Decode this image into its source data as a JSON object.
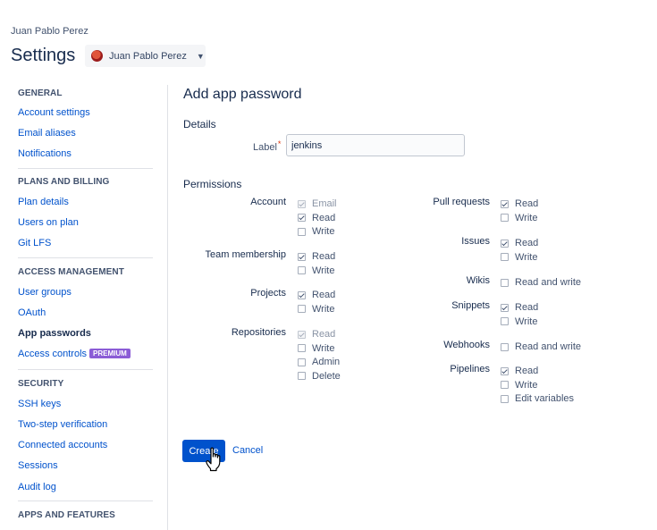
{
  "breadcrumb": "Juan Pablo Perez",
  "page_title": "Settings",
  "account_switcher": {
    "name": "Juan Pablo Perez",
    "icon": "chevron-down-icon"
  },
  "sidebar": {
    "general": {
      "heading": "GENERAL",
      "items": [
        "Account settings",
        "Email aliases",
        "Notifications"
      ]
    },
    "plans": {
      "heading": "PLANS AND BILLING",
      "items": [
        "Plan details",
        "Users on plan",
        "Git LFS"
      ]
    },
    "access": {
      "heading": "ACCESS MANAGEMENT",
      "items": [
        "User groups",
        "OAuth",
        "App passwords",
        "Access controls"
      ],
      "active_item": "App passwords",
      "premium_badge": "PREMIUM"
    },
    "security": {
      "heading": "SECURITY",
      "items": [
        "SSH keys",
        "Two-step verification",
        "Connected accounts",
        "Sessions",
        "Audit log"
      ]
    },
    "apps": {
      "heading": "APPS AND FEATURES"
    }
  },
  "form": {
    "title": "Add app password",
    "details_heading": "Details",
    "label_field": {
      "label": "Label",
      "required_marker": "*",
      "value": "jenkins"
    },
    "permissions_heading": "Permissions",
    "left_groups": [
      {
        "name": "Account",
        "options": [
          {
            "label": "Email",
            "checked": true,
            "disabled": true
          },
          {
            "label": "Read",
            "checked": true,
            "disabled": false
          },
          {
            "label": "Write",
            "checked": false,
            "disabled": false
          }
        ]
      },
      {
        "name": "Team membership",
        "options": [
          {
            "label": "Read",
            "checked": true,
            "disabled": false
          },
          {
            "label": "Write",
            "checked": false,
            "disabled": false
          }
        ]
      },
      {
        "name": "Projects",
        "options": [
          {
            "label": "Read",
            "checked": true,
            "disabled": false
          },
          {
            "label": "Write",
            "checked": false,
            "disabled": false
          }
        ]
      },
      {
        "name": "Repositories",
        "options": [
          {
            "label": "Read",
            "checked": true,
            "disabled": true
          },
          {
            "label": "Write",
            "checked": false,
            "disabled": false
          },
          {
            "label": "Admin",
            "checked": false,
            "disabled": false
          },
          {
            "label": "Delete",
            "checked": false,
            "disabled": false
          }
        ]
      }
    ],
    "right_groups": [
      {
        "name": "Pull requests",
        "options": [
          {
            "label": "Read",
            "checked": true,
            "disabled": false
          },
          {
            "label": "Write",
            "checked": false,
            "disabled": false
          }
        ]
      },
      {
        "name": "Issues",
        "options": [
          {
            "label": "Read",
            "checked": true,
            "disabled": false
          },
          {
            "label": "Write",
            "checked": false,
            "disabled": false
          }
        ]
      },
      {
        "name": "Wikis",
        "options": [
          {
            "label": "Read and write",
            "checked": false,
            "disabled": false
          }
        ]
      },
      {
        "name": "Snippets",
        "options": [
          {
            "label": "Read",
            "checked": true,
            "disabled": false
          },
          {
            "label": "Write",
            "checked": false,
            "disabled": false
          }
        ]
      },
      {
        "name": "Webhooks",
        "options": [
          {
            "label": "Read and write",
            "checked": false,
            "disabled": false
          }
        ]
      },
      {
        "name": "Pipelines",
        "options": [
          {
            "label": "Read",
            "checked": true,
            "disabled": false
          },
          {
            "label": "Write",
            "checked": false,
            "disabled": false
          },
          {
            "label": "Edit variables",
            "checked": false,
            "disabled": false
          }
        ]
      }
    ],
    "create_label": "Create",
    "cancel_label": "Cancel"
  },
  "colors": {
    "primary": "#0052cc",
    "premium": "#8b5cd6",
    "required": "#de350b"
  }
}
